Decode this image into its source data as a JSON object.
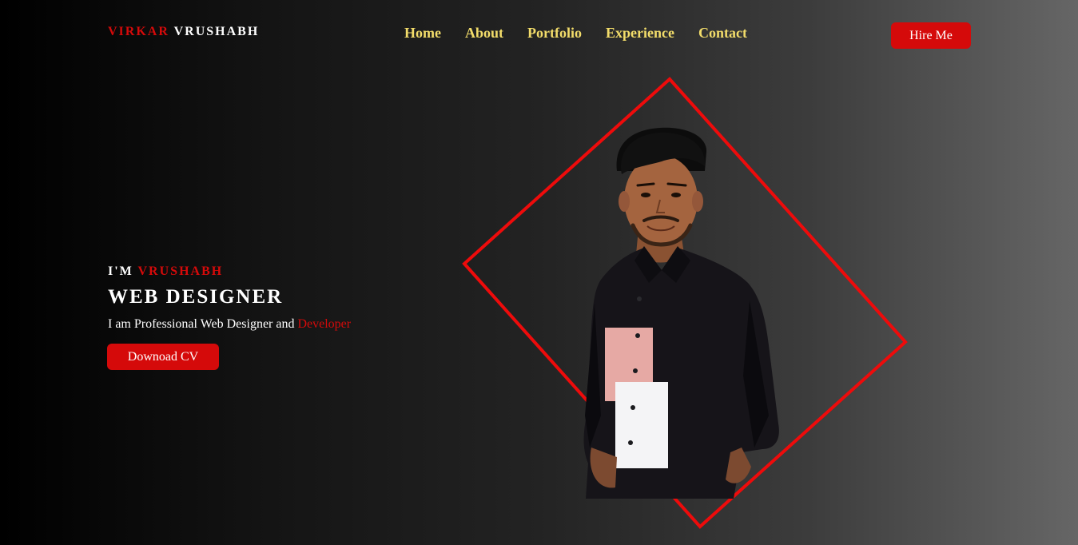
{
  "header": {
    "logo_first": "VIRKAR",
    "logo_last": "VRUSHABH",
    "nav": [
      "Home",
      "About",
      "Portfolio",
      "Experience",
      "Contact"
    ],
    "hire_label": "Hire Me"
  },
  "hero": {
    "intro_prefix": "I'M",
    "intro_name": "VRUSHABH",
    "role": "WEB DESIGNER",
    "tagline_text": "I am Professional Web Designer and",
    "tagline_highlight": "Developer",
    "cv_label": "Downoad CV",
    "photo_icon": "person-portrait-photo"
  },
  "colors": {
    "accent": "#d50a0a",
    "nav_text": "#f2dc6a",
    "diamond_stroke": "#ee0b0b"
  }
}
